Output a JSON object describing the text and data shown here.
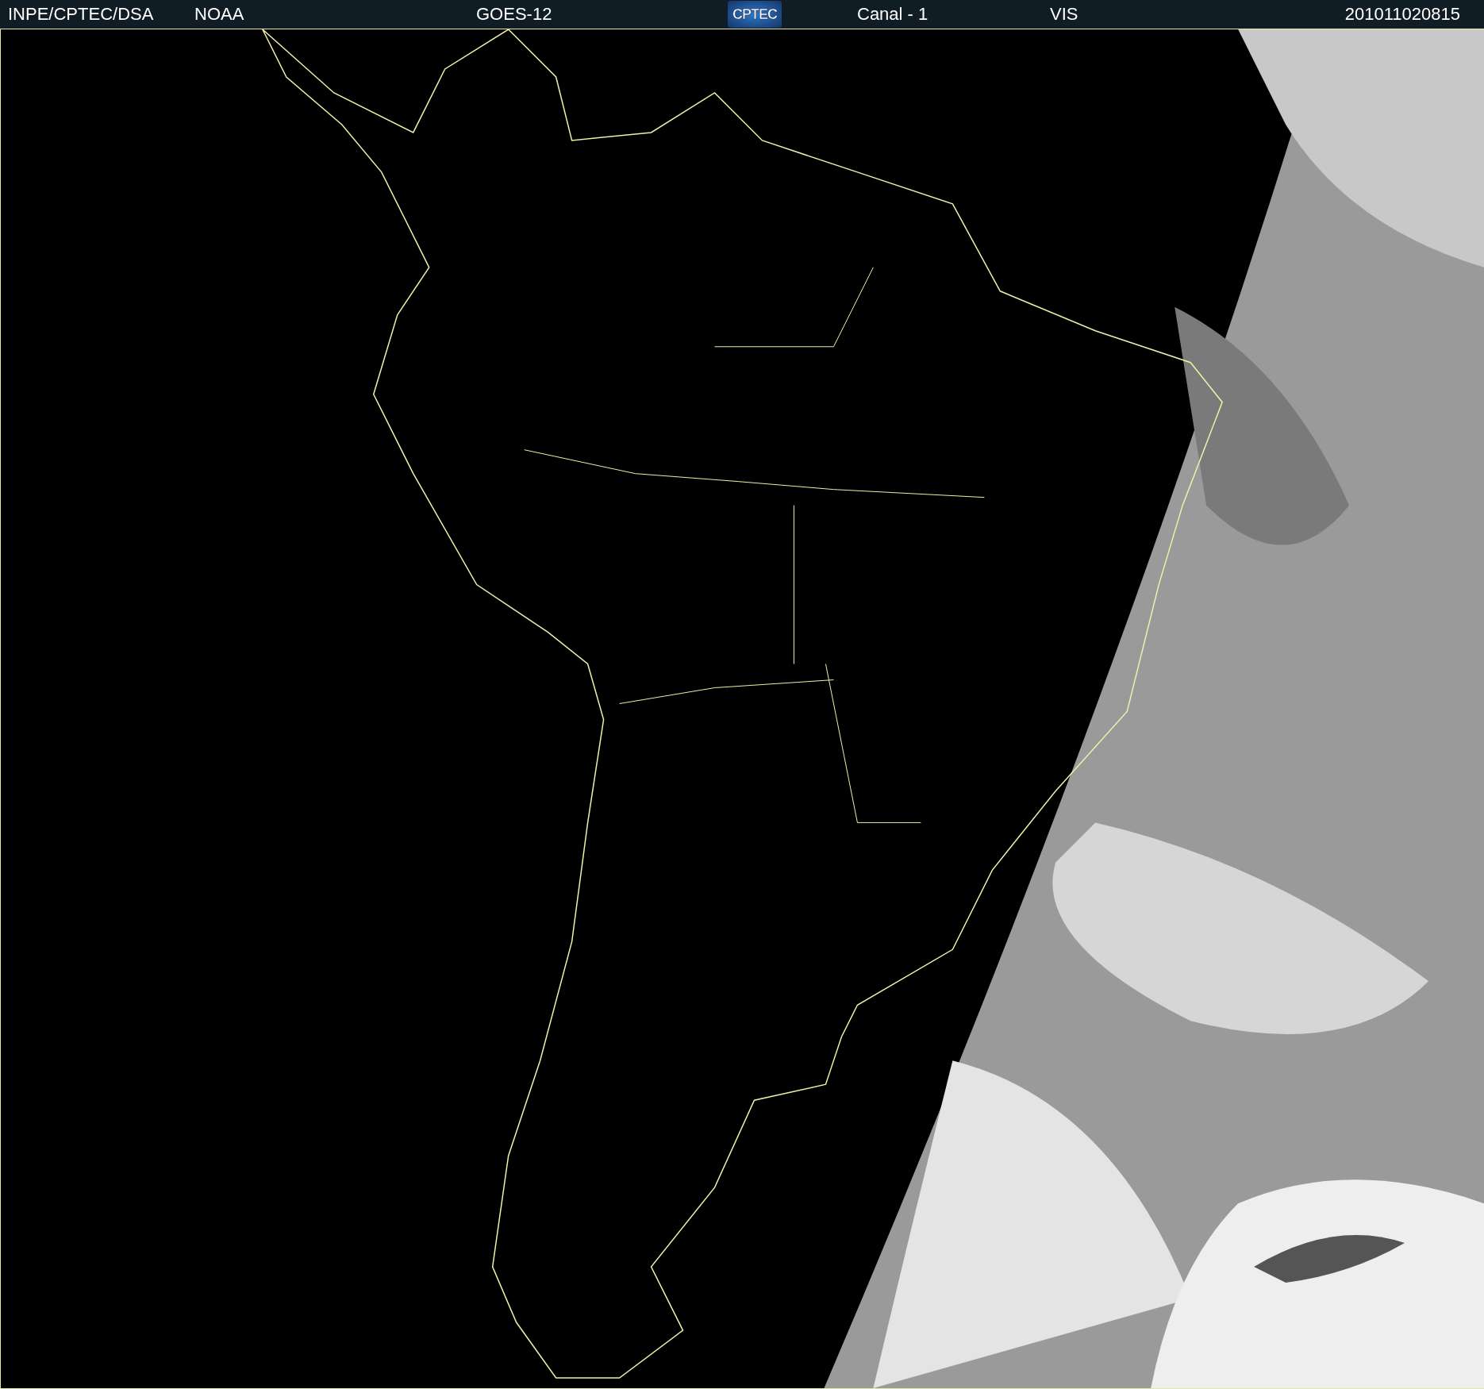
{
  "header": {
    "items": [
      {
        "kind": "text",
        "text": "INPE/CPTEC/DSA"
      },
      {
        "kind": "text",
        "text": "NOAA"
      },
      {
        "kind": "text",
        "text": "GOES-12"
      },
      {
        "kind": "logo",
        "text": "CPTEC"
      },
      {
        "kind": "text",
        "text": "Canal - 1"
      },
      {
        "kind": "text",
        "text": "VIS"
      },
      {
        "kind": "text",
        "text": "201011020815"
      }
    ]
  }
}
